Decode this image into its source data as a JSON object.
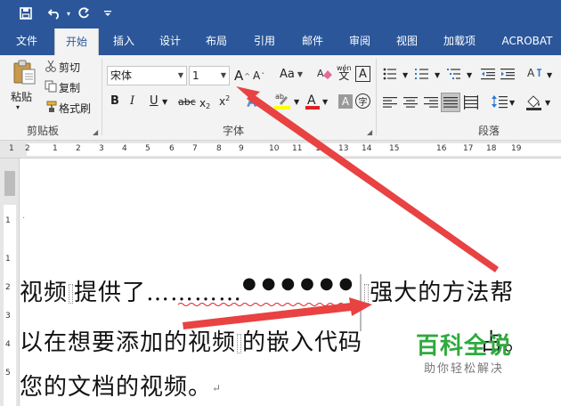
{
  "colors": {
    "accent": "#2b579a",
    "arrow": "#e84242",
    "watermark": "#2eaa3e",
    "squiggle": "#e02020"
  },
  "tabs": [
    "文件",
    "开始",
    "插入",
    "设计",
    "布局",
    "引用",
    "邮件",
    "审阅",
    "视图",
    "加载项",
    "ACROBAT"
  ],
  "clipboard": {
    "paste": "粘贴",
    "cut": "剪切",
    "copy": "复制",
    "format_painter": "格式刷",
    "group_label": "剪贴板"
  },
  "font": {
    "font_name": "宋体",
    "font_size": "1",
    "group_label": "字体",
    "grow_glyph": "A",
    "shrink_glyph": "A",
    "change_case": "Aa",
    "phonetic": "wén",
    "bold": "B",
    "italic": "I",
    "underline": "U",
    "strike": "abc",
    "subscript": "x",
    "sub_mark": "2",
    "superscript": "x",
    "sup_mark": "2",
    "enclose": "字"
  },
  "paragraph": {
    "group_label": "段落"
  },
  "ruler": {
    "numbers": [
      "1",
      "2",
      "1",
      "2",
      "3",
      "4",
      "5",
      "6",
      "7",
      "8",
      "9",
      "10",
      "11",
      "12",
      "13",
      "14",
      "15",
      "16",
      "17",
      "18",
      "19"
    ],
    "vnumbers": [
      "1",
      "1",
      "2",
      "3",
      "4",
      "5"
    ]
  },
  "document": {
    "line1_a": "视频",
    "line1_b": "提供了…………",
    "line1_dots": "●●●●●●",
    "line1_c": "强大的方法帮",
    "line2_a": "以在想要添加的视频",
    "line2_b": "的嵌入代码",
    "line2_c": "占。",
    "line3": "您的文档的视频。",
    "para_mark": "↵"
  },
  "watermark": {
    "title": "百科全说",
    "subtitle": "助你轻松解决"
  }
}
